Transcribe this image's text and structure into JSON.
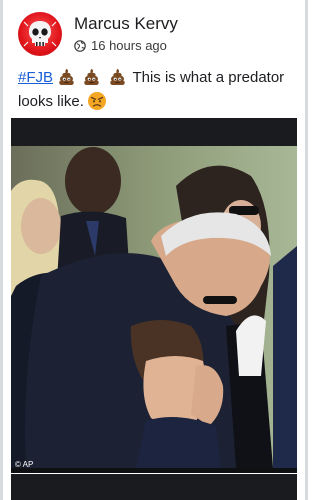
{
  "post": {
    "author": "Marcus Kervy",
    "time": "16 hours ago",
    "privacy_icon": "globe-icon",
    "text": {
      "hashtag": "#FJB",
      "emojis": [
        "pile-of-poo",
        "pile-of-poo",
        "pile-of-poo"
      ],
      "body": "This is what a predator looks like.",
      "trailing_emoji": "angry-face"
    },
    "photo": {
      "credit": "© AP"
    }
  },
  "colors": {
    "avatar_red": "#e0141a",
    "hashtag_blue": "#1a5fd6",
    "photo_frame": "#1a1b1e"
  }
}
